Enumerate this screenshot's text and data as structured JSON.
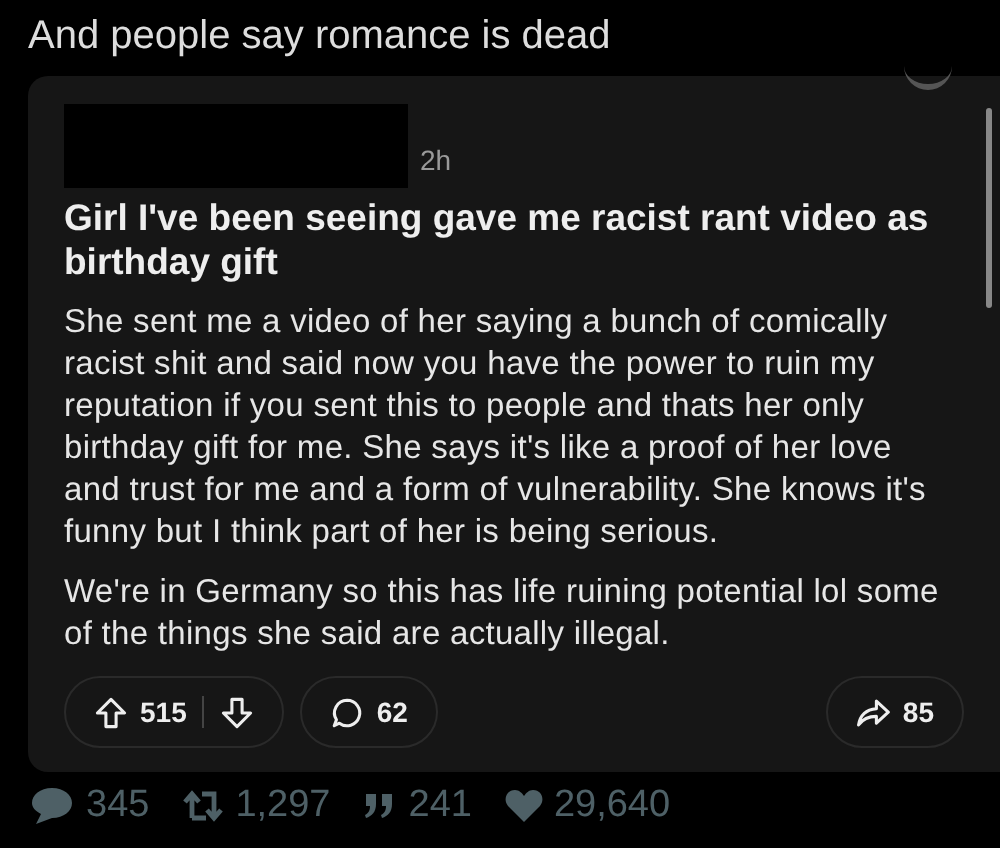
{
  "caption": "And people say romance is dead",
  "post": {
    "time": "2h",
    "title": "Girl I've been seeing gave me racist rant video as birthday gift",
    "paragraphs": [
      "She sent me a video of her saying a bunch of comically racist shit and said now you have the power to ruin my reputation if you sent this to people and thats her only birthday gift for me. She says it's like a proof of her love and trust for me and a form of vulnerability. She knows it's funny but I think part of her is being serious.",
      "We're in Germany so this has life ruining potential lol some of the things she said are actually illegal."
    ],
    "upvotes": "515",
    "comments": "62",
    "shares": "85"
  },
  "stats": [
    {
      "kind": "reply",
      "count": "345"
    },
    {
      "kind": "retweet",
      "count": "1,297"
    },
    {
      "kind": "quote",
      "count": "241"
    },
    {
      "kind": "like",
      "count": "29,640"
    }
  ]
}
